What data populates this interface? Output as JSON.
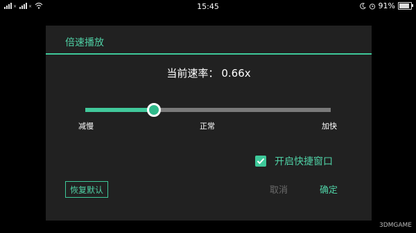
{
  "status_bar": {
    "time": "15:45",
    "battery": "91%",
    "battery_level": 0.91,
    "icons": [
      "signal-icon",
      "signal-icon",
      "wifi-icon",
      "no-disturb-icon",
      "alarm-icon",
      "battery-icon"
    ]
  },
  "dialog": {
    "title": "倍速播放",
    "speed_label": "当前速率：",
    "speed_value": "0.66x",
    "slider": {
      "value_fraction": 0.28,
      "marks": {
        "slow": "减慢",
        "normal": "正常",
        "fast": "加快"
      }
    },
    "checkbox": {
      "checked": true,
      "label": "开启快捷窗口"
    },
    "buttons": {
      "reset": "恢复默认",
      "cancel": "取消",
      "ok": "确定"
    }
  },
  "colors": {
    "accent": "#3ec99a",
    "dialog_bg": "#212121",
    "track": "#7a7a7a",
    "disabled_text": "#6b6b6b"
  },
  "watermark": "3DMGAME"
}
